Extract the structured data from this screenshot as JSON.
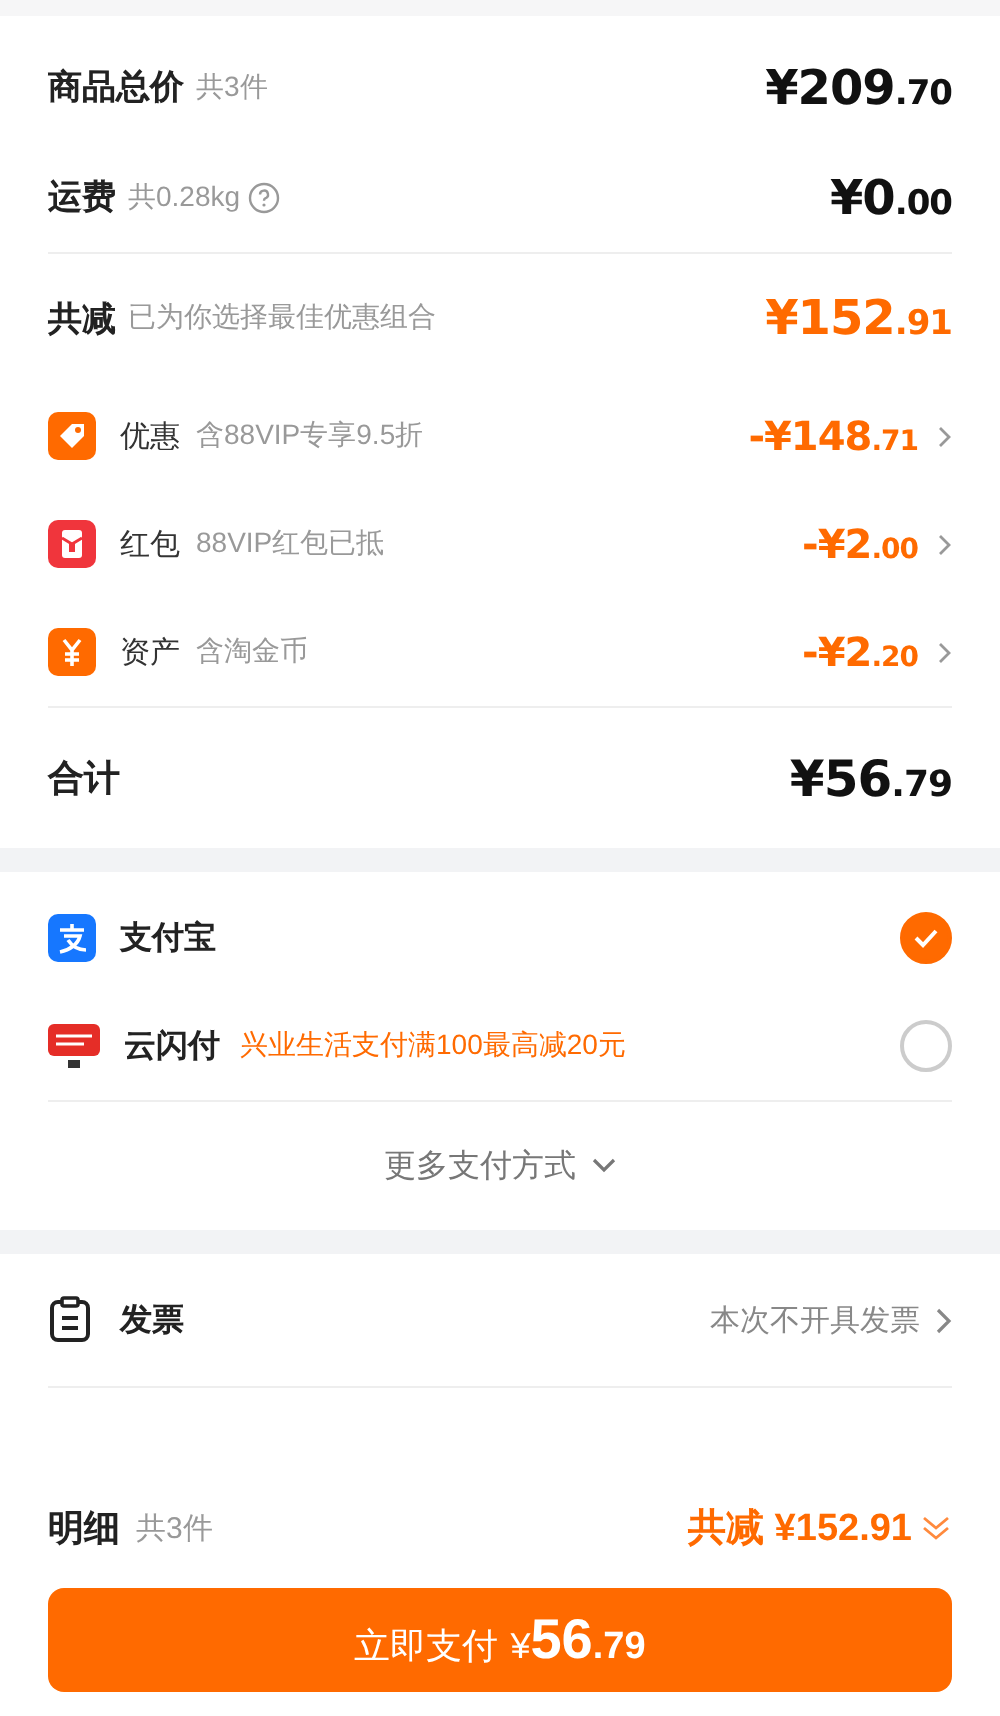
{
  "totals": [
    {
      "label": "商品总价",
      "note": "共3件",
      "amount": "¥209",
      "decimals": ".70"
    },
    {
      "label": "运费",
      "note": "共0.28kg",
      "help": true,
      "amount": "¥0",
      "decimals": ".00"
    }
  ],
  "savings": {
    "label": "共减",
    "note": "已为你选择最佳优惠组合",
    "amount": "¥152",
    "decimals": ".91",
    "items": [
      {
        "kind": "coupon",
        "label": "优惠",
        "note": "含88VIP专享9.5折",
        "amount": "-¥148",
        "decimals": ".71"
      },
      {
        "kind": "red_packet",
        "label": "红包",
        "note": "88VIP红包已抵",
        "amount": "-¥2",
        "decimals": ".00"
      },
      {
        "kind": "coins",
        "label": "资产",
        "note": "含淘金币",
        "amount": "-¥2",
        "decimals": ".20"
      }
    ]
  },
  "grand_total": {
    "label": "合计",
    "amount": "¥56",
    "decimals": ".79"
  },
  "payment_methods": [
    {
      "kind": "alipay",
      "name": "支付宝",
      "selected": true
    },
    {
      "kind": "quickpass",
      "name": "云闪付",
      "promo": "兴业生活支付满100最高减20元",
      "selected": false
    }
  ],
  "more_payment": "更多支付方式",
  "invoice": {
    "label": "发票",
    "value": "本次不开具发票"
  },
  "bottom_bar": {
    "label": "明细",
    "count": "共3件",
    "savings": "共减 ¥152.91",
    "pay_button": {
      "label": "立即支付",
      "currency": "¥",
      "amount": "56",
      "decimals": ".79"
    }
  }
}
